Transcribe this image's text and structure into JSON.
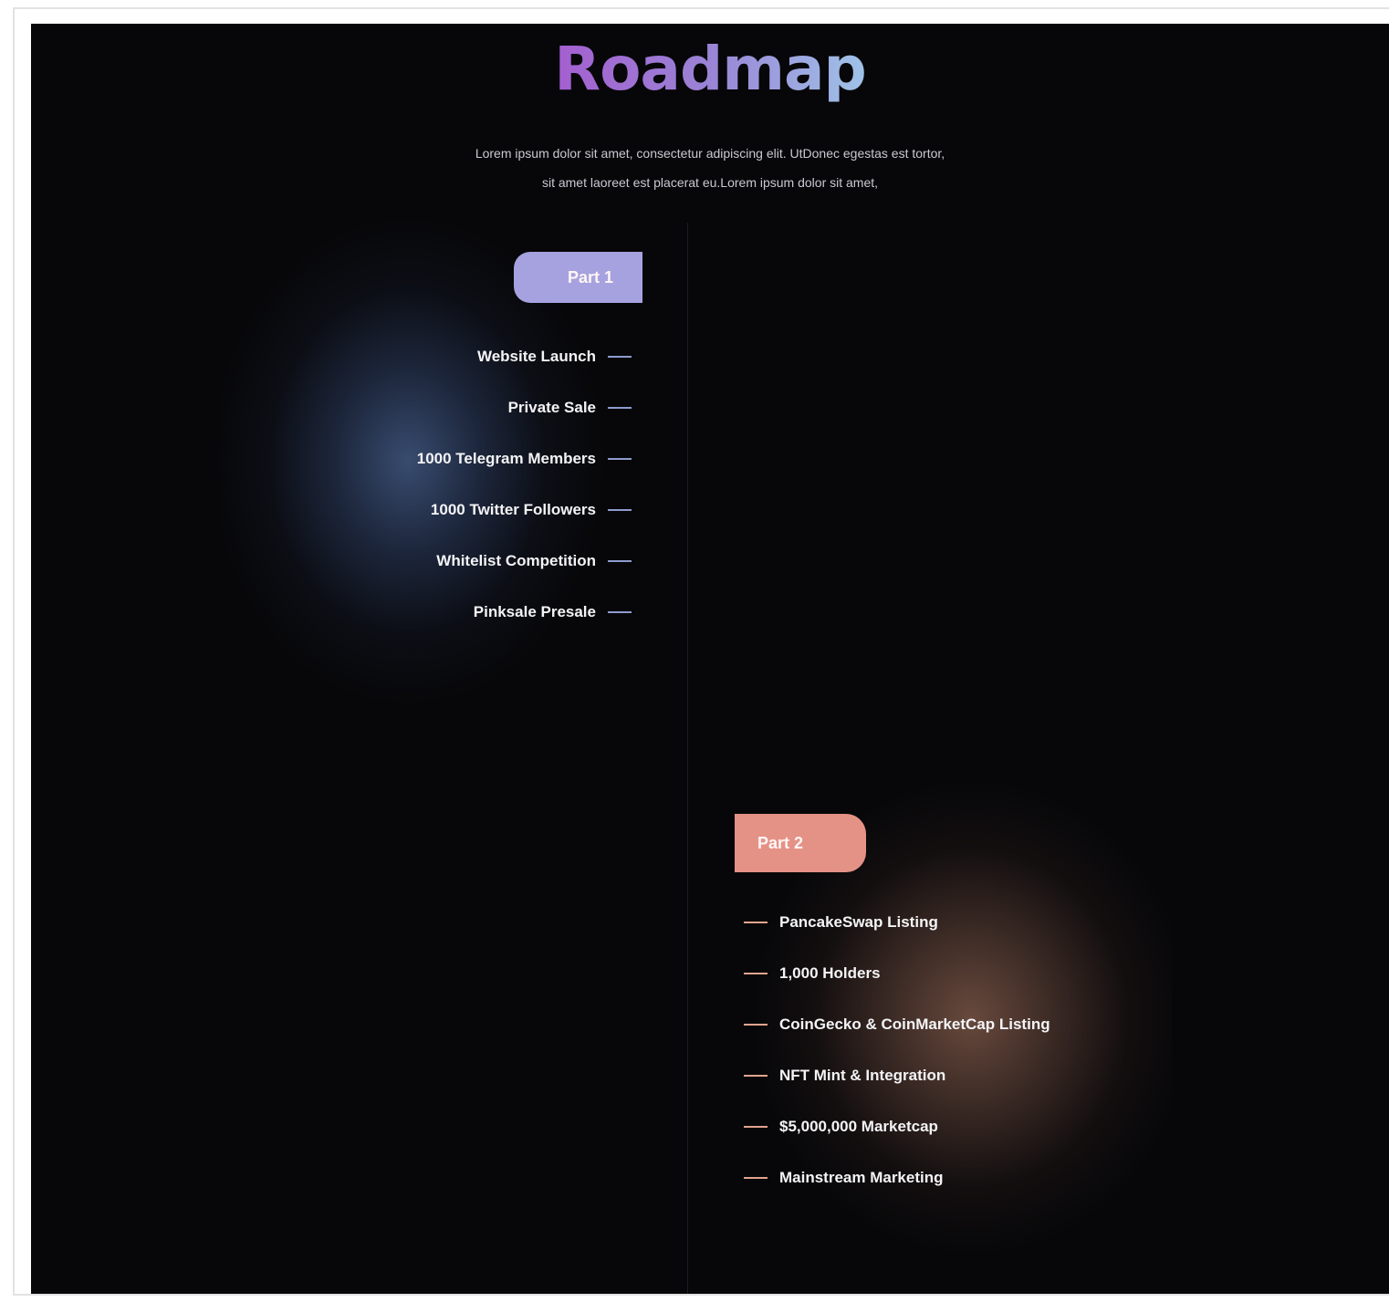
{
  "section": {
    "title": "Roadmap",
    "subtitle_lines": [
      "Lorem ipsum dolor sit amet, consectetur adipiscing elit. UtDonec egestas est tortor,",
      "sit amet laoreet est placerat eu.Lorem ipsum dolor sit amet,"
    ]
  },
  "colors": {
    "background": "#070709",
    "part1_accent": "#a6a2df",
    "part2_accent": "#e59286",
    "title_gradient": [
      "#a45fd0",
      "#9a84d6",
      "#9fc3e8"
    ]
  },
  "phases": [
    {
      "label": "Part 1",
      "items": [
        "Website Launch",
        "Private Sale",
        "1000 Telegram Members",
        "1000 Twitter Followers",
        "Whitelist Competition",
        "Pinksale Presale"
      ]
    },
    {
      "label": "Part 2",
      "items": [
        "PancakeSwap Listing",
        "1,000 Holders",
        "CoinGecko & CoinMarketCap Listing",
        "NFT Mint & Integration",
        "$5,000,000 Marketcap",
        "Mainstream Marketing"
      ]
    }
  ]
}
